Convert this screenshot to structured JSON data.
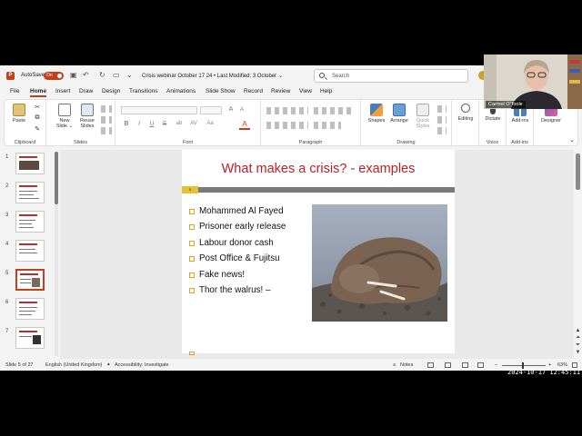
{
  "titlebar": {
    "logo_glyph": "P",
    "autosave_label": "AutoSave",
    "autosave_state": "On",
    "doc_title": "Crisis webinar October 17 24  •  Last Modified: 3 October ⌄",
    "search_placeholder": "Search"
  },
  "menu": {
    "tabs": [
      {
        "label": "File"
      },
      {
        "label": "Home",
        "active": true
      },
      {
        "label": "Insert"
      },
      {
        "label": "Draw"
      },
      {
        "label": "Design"
      },
      {
        "label": "Transitions"
      },
      {
        "label": "Animations"
      },
      {
        "label": "Slide Show"
      },
      {
        "label": "Record"
      },
      {
        "label": "Review"
      },
      {
        "label": "View"
      },
      {
        "label": "Help"
      }
    ]
  },
  "ribbon": {
    "groups": {
      "clipboard": "Clipboard",
      "slides": "Slides",
      "font": "Font",
      "paragraph": "Paragraph",
      "drawing": "Drawing",
      "voice": "Voice",
      "addins": "Add-ins"
    },
    "buttons": {
      "paste": "Paste",
      "new_slide": "New Slide ⌄",
      "reuse_slides": "Reuse Slides",
      "shapes": "Shapes",
      "arrange": "Arrange",
      "quick_styles": "Quick Styles",
      "editing": "Editing",
      "dictate": "Dictate",
      "addins": "Add-ins",
      "designer": "Designer"
    },
    "font_buttons": [
      "B",
      "I",
      "U",
      "S",
      "ab",
      "AV",
      "Aa",
      "A"
    ]
  },
  "thumbnails": {
    "numbers": [
      "1",
      "2",
      "3",
      "4",
      "5",
      "6",
      "7"
    ],
    "selected_index": 4
  },
  "slide": {
    "title": "What makes a crisis?  - examples",
    "slide_number": "5",
    "bullets": [
      "Mohammed Al Fayed",
      "Prisoner early release",
      "Labour donor cash",
      "Post Office & Fujitsu",
      "Fake news!",
      "Thor the walrus! –"
    ]
  },
  "status": {
    "slide_counter": "Slide 5 of 27",
    "language": "English (United Kingdom)",
    "accessibility": "Accessibility: Investigate",
    "notes": "Notes",
    "zoom": "63%"
  },
  "webcam": {
    "name": "Carmel O'Toole"
  },
  "timestamp": "2024-10-17  12:45:11",
  "colors": {
    "accent": "#c43e1c",
    "slide_title": "#b5222a",
    "bullet": "#d4a628"
  }
}
